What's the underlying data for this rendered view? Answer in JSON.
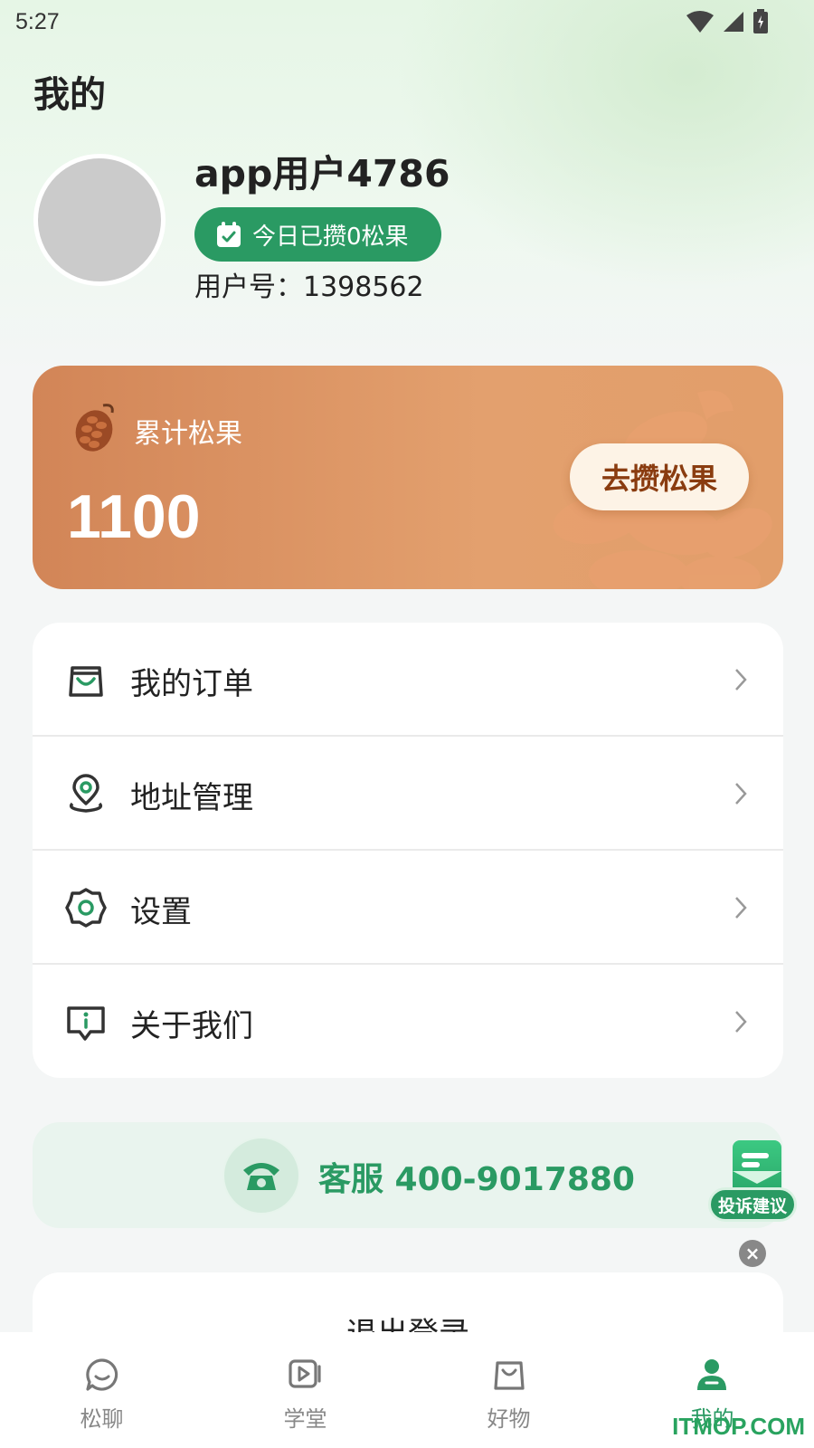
{
  "status_bar": {
    "time": "5:27"
  },
  "page_title": "我的",
  "profile": {
    "username": "app用户4786",
    "today_badge": "今日已攒0松果",
    "user_id": "用户号：1398562"
  },
  "pine_card": {
    "label": "累计松果",
    "total": "1100",
    "collect_button": "去攒松果"
  },
  "menu": {
    "items": [
      {
        "label": "我的订单",
        "icon": "shopping-bag-icon"
      },
      {
        "label": "地址管理",
        "icon": "location-pin-icon"
      },
      {
        "label": "设置",
        "icon": "gear-icon"
      },
      {
        "label": "关于我们",
        "icon": "info-message-icon"
      }
    ]
  },
  "service": {
    "text": "客服 400-9017880"
  },
  "feedback": {
    "label": "投诉建议"
  },
  "logout": {
    "label": "退出登录"
  },
  "tab_bar": {
    "tabs": [
      {
        "label": "松聊",
        "icon": "chat-icon"
      },
      {
        "label": "学堂",
        "icon": "video-play-icon"
      },
      {
        "label": "好物",
        "icon": "bag-icon"
      },
      {
        "label": "我的",
        "icon": "person-icon",
        "active": true
      }
    ]
  },
  "watermark": "ITMOP.COM",
  "colors": {
    "accent_green": "#2a9a63",
    "pine_card_orange": "#d9915f",
    "button_cream": "#fdf3e6"
  }
}
